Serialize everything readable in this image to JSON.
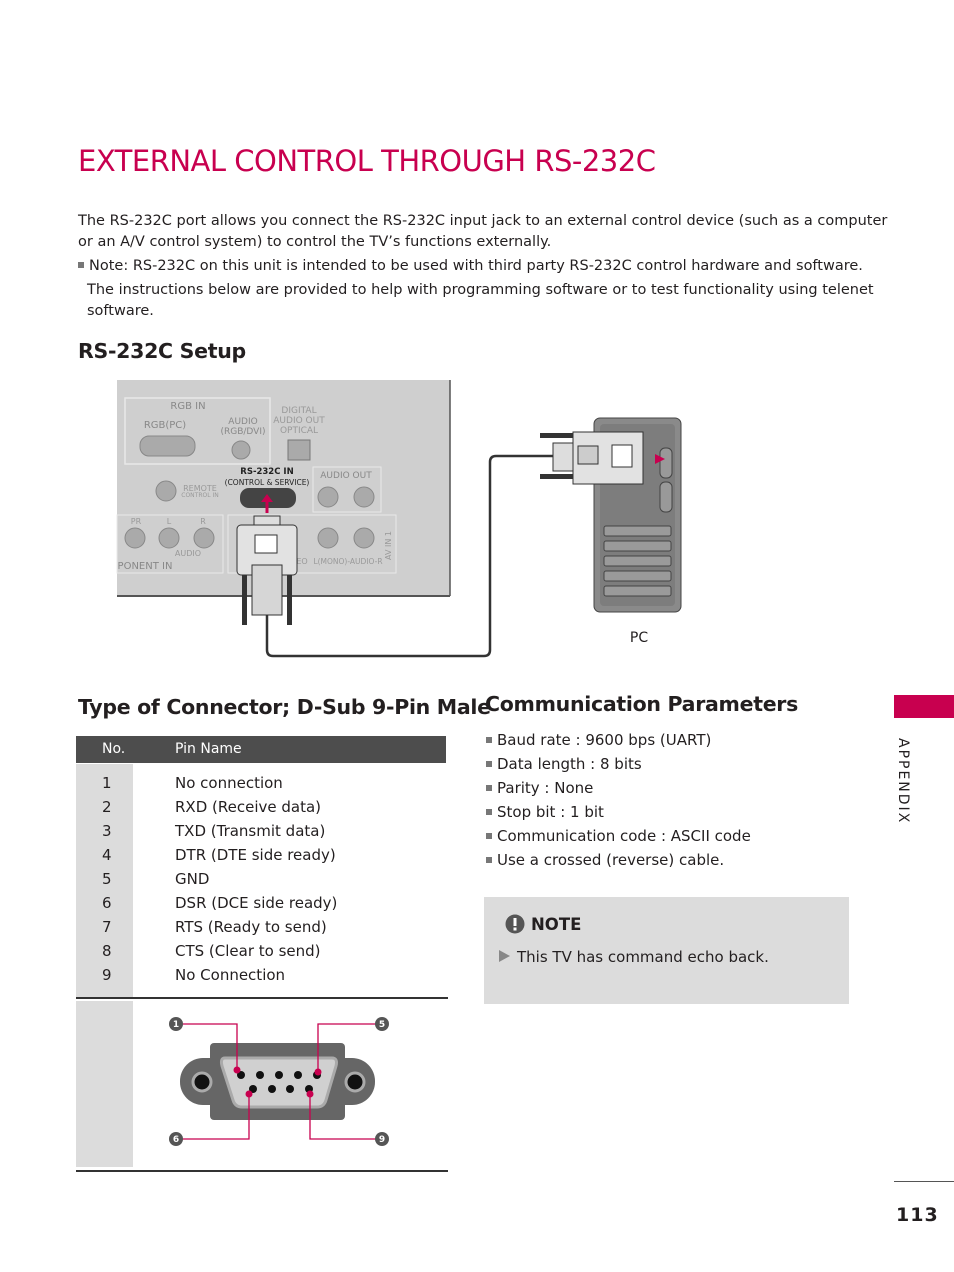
{
  "title": "EXTERNAL CONTROL THROUGH RS-232C",
  "intro": {
    "para1_line1": "The RS-232C port allows you connect the RS-232C input jack to an external control device (such as a computer",
    "para1_line2": "or an A/V control system) to control the TV’s functions externally.",
    "note_line1": "Note: RS-232C on this unit is intended to be used with third party RS-232C control hardware and software.",
    "note_line2": "The instructions below are provided to help with programming software or to test functionality using telenet",
    "note_line3": "software."
  },
  "setup": {
    "heading": "RS-232C Setup",
    "panel_labels": {
      "rgb_in": "RGB IN",
      "rgb_pc": "RGB(PC)",
      "audio": "AUDIO",
      "rgb_dvi": "(RGB/DVI)",
      "digital": "DIGITAL",
      "audio_out_l": "AUDIO OUT",
      "optical": "OPTICAL",
      "rs232c_in": "RS-232C IN",
      "control_service": "(CONTROL & SERVICE)",
      "remote": "REMOTE",
      "control_in": "CONTROL IN",
      "audio_out": "AUDIO OUT",
      "pr": "PR",
      "l": "L",
      "r": "R",
      "audio_sub": "AUDIO",
      "component_in": "PONENT IN",
      "video": "EO",
      "audio_lr": "L(MONO)-AUDIO-R",
      "av_in_1": "AV IN 1"
    },
    "pc_label": "PC",
    "accent": "#c8004f"
  },
  "connector": {
    "heading": "Type of Connector; D-Sub 9-Pin Male",
    "columns": [
      "No.",
      "Pin Name"
    ],
    "pins": [
      {
        "no": "1",
        "name": "No connection"
      },
      {
        "no": "2",
        "name": "RXD (Receive data)"
      },
      {
        "no": "3",
        "name": "TXD (Transmit data)"
      },
      {
        "no": "4",
        "name": "DTR (DTE side ready)"
      },
      {
        "no": "5",
        "name": "GND"
      },
      {
        "no": "6",
        "name": "DSR (DCE side ready)"
      },
      {
        "no": "7",
        "name": "RTS (Ready to send)"
      },
      {
        "no": "8",
        "name": "CTS (Clear to send)"
      },
      {
        "no": "9",
        "name": "No Connection"
      }
    ],
    "diagram_pins": [
      "1",
      "5",
      "6",
      "9"
    ]
  },
  "comm": {
    "heading": "Communication Parameters",
    "items": [
      "Baud rate : 9600 bps (UART)",
      "Data length : 8 bits",
      "Parity : None",
      "Stop bit : 1 bit",
      "Communication code : ASCII code",
      "Use a crossed (reverse) cable."
    ]
  },
  "note": {
    "title": "NOTE",
    "text": "This TV has command echo back.",
    "icon": "exclamation-icon"
  },
  "side_tab": "APPENDIX",
  "page_number": "113"
}
